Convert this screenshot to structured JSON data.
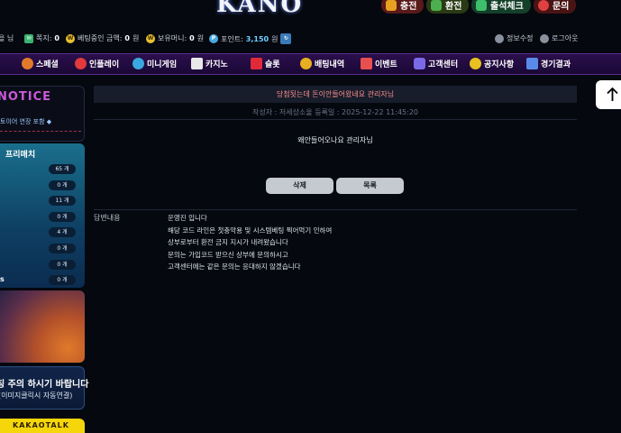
{
  "header": {
    "logo": "KANO",
    "buttons": [
      {
        "label": "충전",
        "color": "#5a1a1a",
        "icon": "charge-icon",
        "icon_color": "#e8a020"
      },
      {
        "label": "환전",
        "color": "#2a3a14",
        "icon": "exchange-icon",
        "icon_color": "#4caf50"
      },
      {
        "label": "출석체크",
        "color": "#14402a",
        "icon": "attendance-check-icon",
        "icon_color": "#3fbf6a"
      },
      {
        "label": "문의",
        "color": "#4a1414",
        "icon": "inquiry-icon",
        "icon_color": "#e04040"
      }
    ]
  },
  "info": {
    "user_suffix": "을 님",
    "note_label": "쪽지:",
    "note_value": "0",
    "bet_label": "베팅중인 금액:",
    "bet_value": "0",
    "bet_unit": "원",
    "money_label": "보유머니:",
    "money_value": "0",
    "money_unit": "원",
    "point_label": "포인트:",
    "point_value": "3,150",
    "point_unit": "원",
    "profile": "정보수정",
    "logout": "로그아웃"
  },
  "nav": [
    {
      "label": "스페셜",
      "icon": "basketball-icon",
      "color": "#e07a2a"
    },
    {
      "label": "인플레이",
      "icon": "play-icon",
      "color": "#e03a3a"
    },
    {
      "label": "미니게임",
      "icon": "eye-icon",
      "color": "#3aa8e0"
    },
    {
      "label": "카지노",
      "icon": "playing-card-icon",
      "color": "#e8e8e8"
    },
    {
      "label": "슬롯",
      "icon": "seven-icon",
      "color": "#e02a3a"
    },
    {
      "label": "배팅내역",
      "icon": "trophy-icon",
      "color": "#e8b020"
    },
    {
      "label": "이벤트",
      "icon": "calendar-icon",
      "color": "#e85050"
    },
    {
      "label": "고객센터",
      "icon": "chat-icon",
      "color": "#7a6ae8"
    },
    {
      "label": "공지사항",
      "icon": "bell-icon",
      "color": "#e8c020"
    },
    {
      "label": "경기결과",
      "icon": "scoreboard-icon",
      "color": "#5a8ae8"
    }
  ],
  "sidebar": {
    "notice_title": "NOTICE",
    "notice_text": "토이어 연장 포함 ◆",
    "match_title": "프리매치",
    "match_counts": [
      "65 개",
      "0 개",
      "11 개",
      "0 개",
      "4 개",
      "0 개",
      "0 개",
      "0 개"
    ],
    "match_last_label": "s",
    "warn_line1": "칭 주의 하시기 바랍니다",
    "warn_line2": "(이미지클릭시 자동연결)",
    "kakao": "KAKAOTALK"
  },
  "post": {
    "title": "당첨됫는데 돈이안들어왔네요 관리자님",
    "meta": "작성자 : 저세상소울   등록일 : 2025-12-22 11:45:20",
    "body": "왜안들어오나요 관리자님",
    "delete_label": "삭제",
    "list_label": "목록",
    "answer_label": "답변내용",
    "answer_lines": [
      "운영진 입니다",
      "해당 코드 라인은 첫충악용 및 시스템베팅 찍어먹기 인하여",
      "상부로부터 환전 금지 지시가 내려왔습니다",
      "문의는 가입코드 받으신 상부에 문의하시고",
      "고객센터에는 같은 문의는 응대하지 않겠습니다"
    ]
  }
}
